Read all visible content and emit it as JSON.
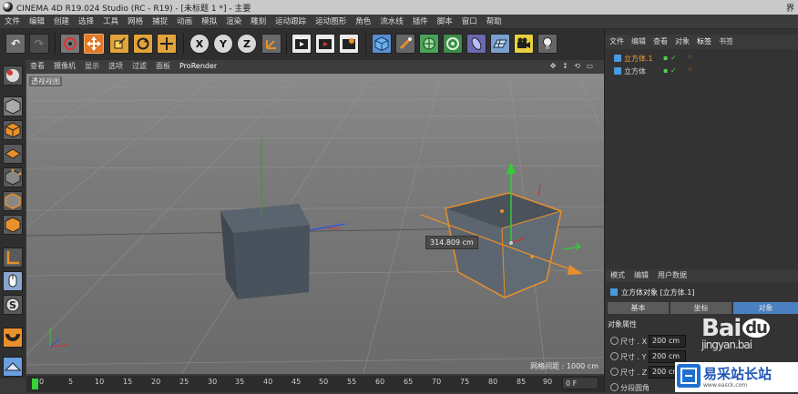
{
  "window": {
    "title": "CINEMA 4D R19.024 Studio (RC - R19) - [未标题 1 *] - 主要",
    "corner_text": "界"
  },
  "menubar": [
    "文件",
    "编辑",
    "创建",
    "选择",
    "工具",
    "网格",
    "捕捉",
    "动画",
    "模拟",
    "渲染",
    "雕刻",
    "运动跟踪",
    "运动图形",
    "角色",
    "流水线",
    "插件",
    "脚本",
    "窗口",
    "帮助"
  ],
  "toolbar": {
    "undo": "undo-icon",
    "axis_x": "X",
    "axis_y": "Y",
    "axis_z": "Z"
  },
  "viewport": {
    "menu": [
      "查看",
      "摄像机",
      "显示",
      "选项",
      "过滤",
      "面板"
    ],
    "renderer": "ProRender",
    "nav_controls": "✥ ↕ ⟲ ▭",
    "label": "透视视图",
    "measure": "314.809 cm",
    "grid_spacing": "网格间距 : 1000 cm"
  },
  "timeline": {
    "ticks": [
      "0",
      "5",
      "10",
      "15",
      "20",
      "25",
      "30",
      "35",
      "40",
      "45",
      "50",
      "55",
      "60",
      "65",
      "70",
      "75",
      "80",
      "85",
      "90"
    ],
    "current_frame": "0 F"
  },
  "object_manager": {
    "tabs": [
      "文件",
      "编辑",
      "查看",
      "对象",
      "标签",
      "书签"
    ],
    "objects": [
      {
        "name": "立方体.1",
        "selected": true
      },
      {
        "name": "立方体",
        "selected": false
      }
    ]
  },
  "attribute_manager": {
    "tabs": [
      "模式",
      "编辑",
      "用户数据"
    ],
    "object_title": "立方体对象 [立方体.1]",
    "sub_tabs": [
      "基本",
      "坐标",
      "对象"
    ],
    "section": "对象属性",
    "fields": [
      {
        "label": "尺寸 . X",
        "value": "200 cm"
      },
      {
        "label": "尺寸 . Y",
        "value": "200 cm"
      },
      {
        "label": "尺寸 . Z",
        "value": "200 cm"
      }
    ],
    "bottom_label": "分段圆角"
  },
  "watermarks": {
    "baidu": "Bai",
    "baidu2": "du",
    "jingyan": "jingyan.bai",
    "site": "易采站长站",
    "site_sub": "www.easck.com"
  },
  "colors": {
    "selection_orange": "#e8902a",
    "axis_green": "#2fd02f",
    "axis_red": "#d03030",
    "axis_blue": "#3050e0"
  }
}
